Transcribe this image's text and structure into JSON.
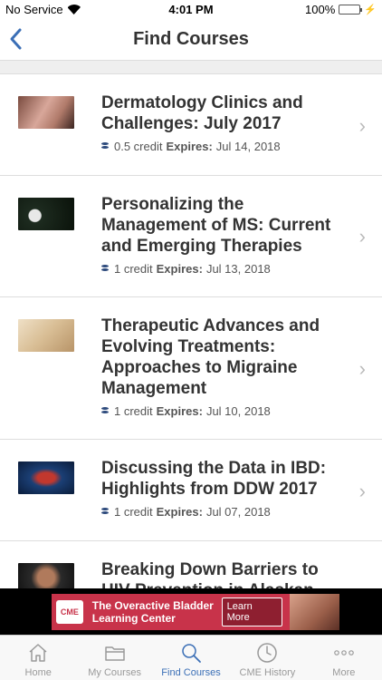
{
  "status": {
    "carrier": "No Service",
    "time": "4:01 PM",
    "battery": "100%"
  },
  "nav": {
    "title": "Find Courses"
  },
  "courses": [
    {
      "title": "Dermatology Clinics and Challenges: July 2017",
      "credit": "0.5 credit",
      "expires_label": "Expires:",
      "expires": "Jul 14, 2018"
    },
    {
      "title": "Personalizing the Management of MS: Current and Emerging Therapies",
      "credit": "1 credit",
      "expires_label": "Expires:",
      "expires": "Jul 13, 2018"
    },
    {
      "title": "Therapeutic Advances and Evolving Treatments: Approaches to Migraine Management",
      "credit": "1 credit",
      "expires_label": "Expires:",
      "expires": "Jul 10, 2018"
    },
    {
      "title": "Discussing the Data in IBD: Highlights from DDW 2017",
      "credit": "1 credit",
      "expires_label": "Expires:",
      "expires": "Jul 07, 2018"
    },
    {
      "title": "Breaking Down Barriers to HIV Prevention in Alaskan",
      "credit": "",
      "expires_label": "",
      "expires": ""
    }
  ],
  "ad": {
    "logo": "CME",
    "headline": "The Overactive Bladder Learning Center",
    "cta": "Learn More"
  },
  "tabs": [
    {
      "label": "Home",
      "icon": "home-icon"
    },
    {
      "label": "My Courses",
      "icon": "folder-icon"
    },
    {
      "label": "Find Courses",
      "icon": "search-icon"
    },
    {
      "label": "CME History",
      "icon": "clock-icon"
    },
    {
      "label": "More",
      "icon": "more-icon"
    }
  ],
  "colors": {
    "accent": "#3b6fb6",
    "ad_bg": "#c8334a"
  }
}
